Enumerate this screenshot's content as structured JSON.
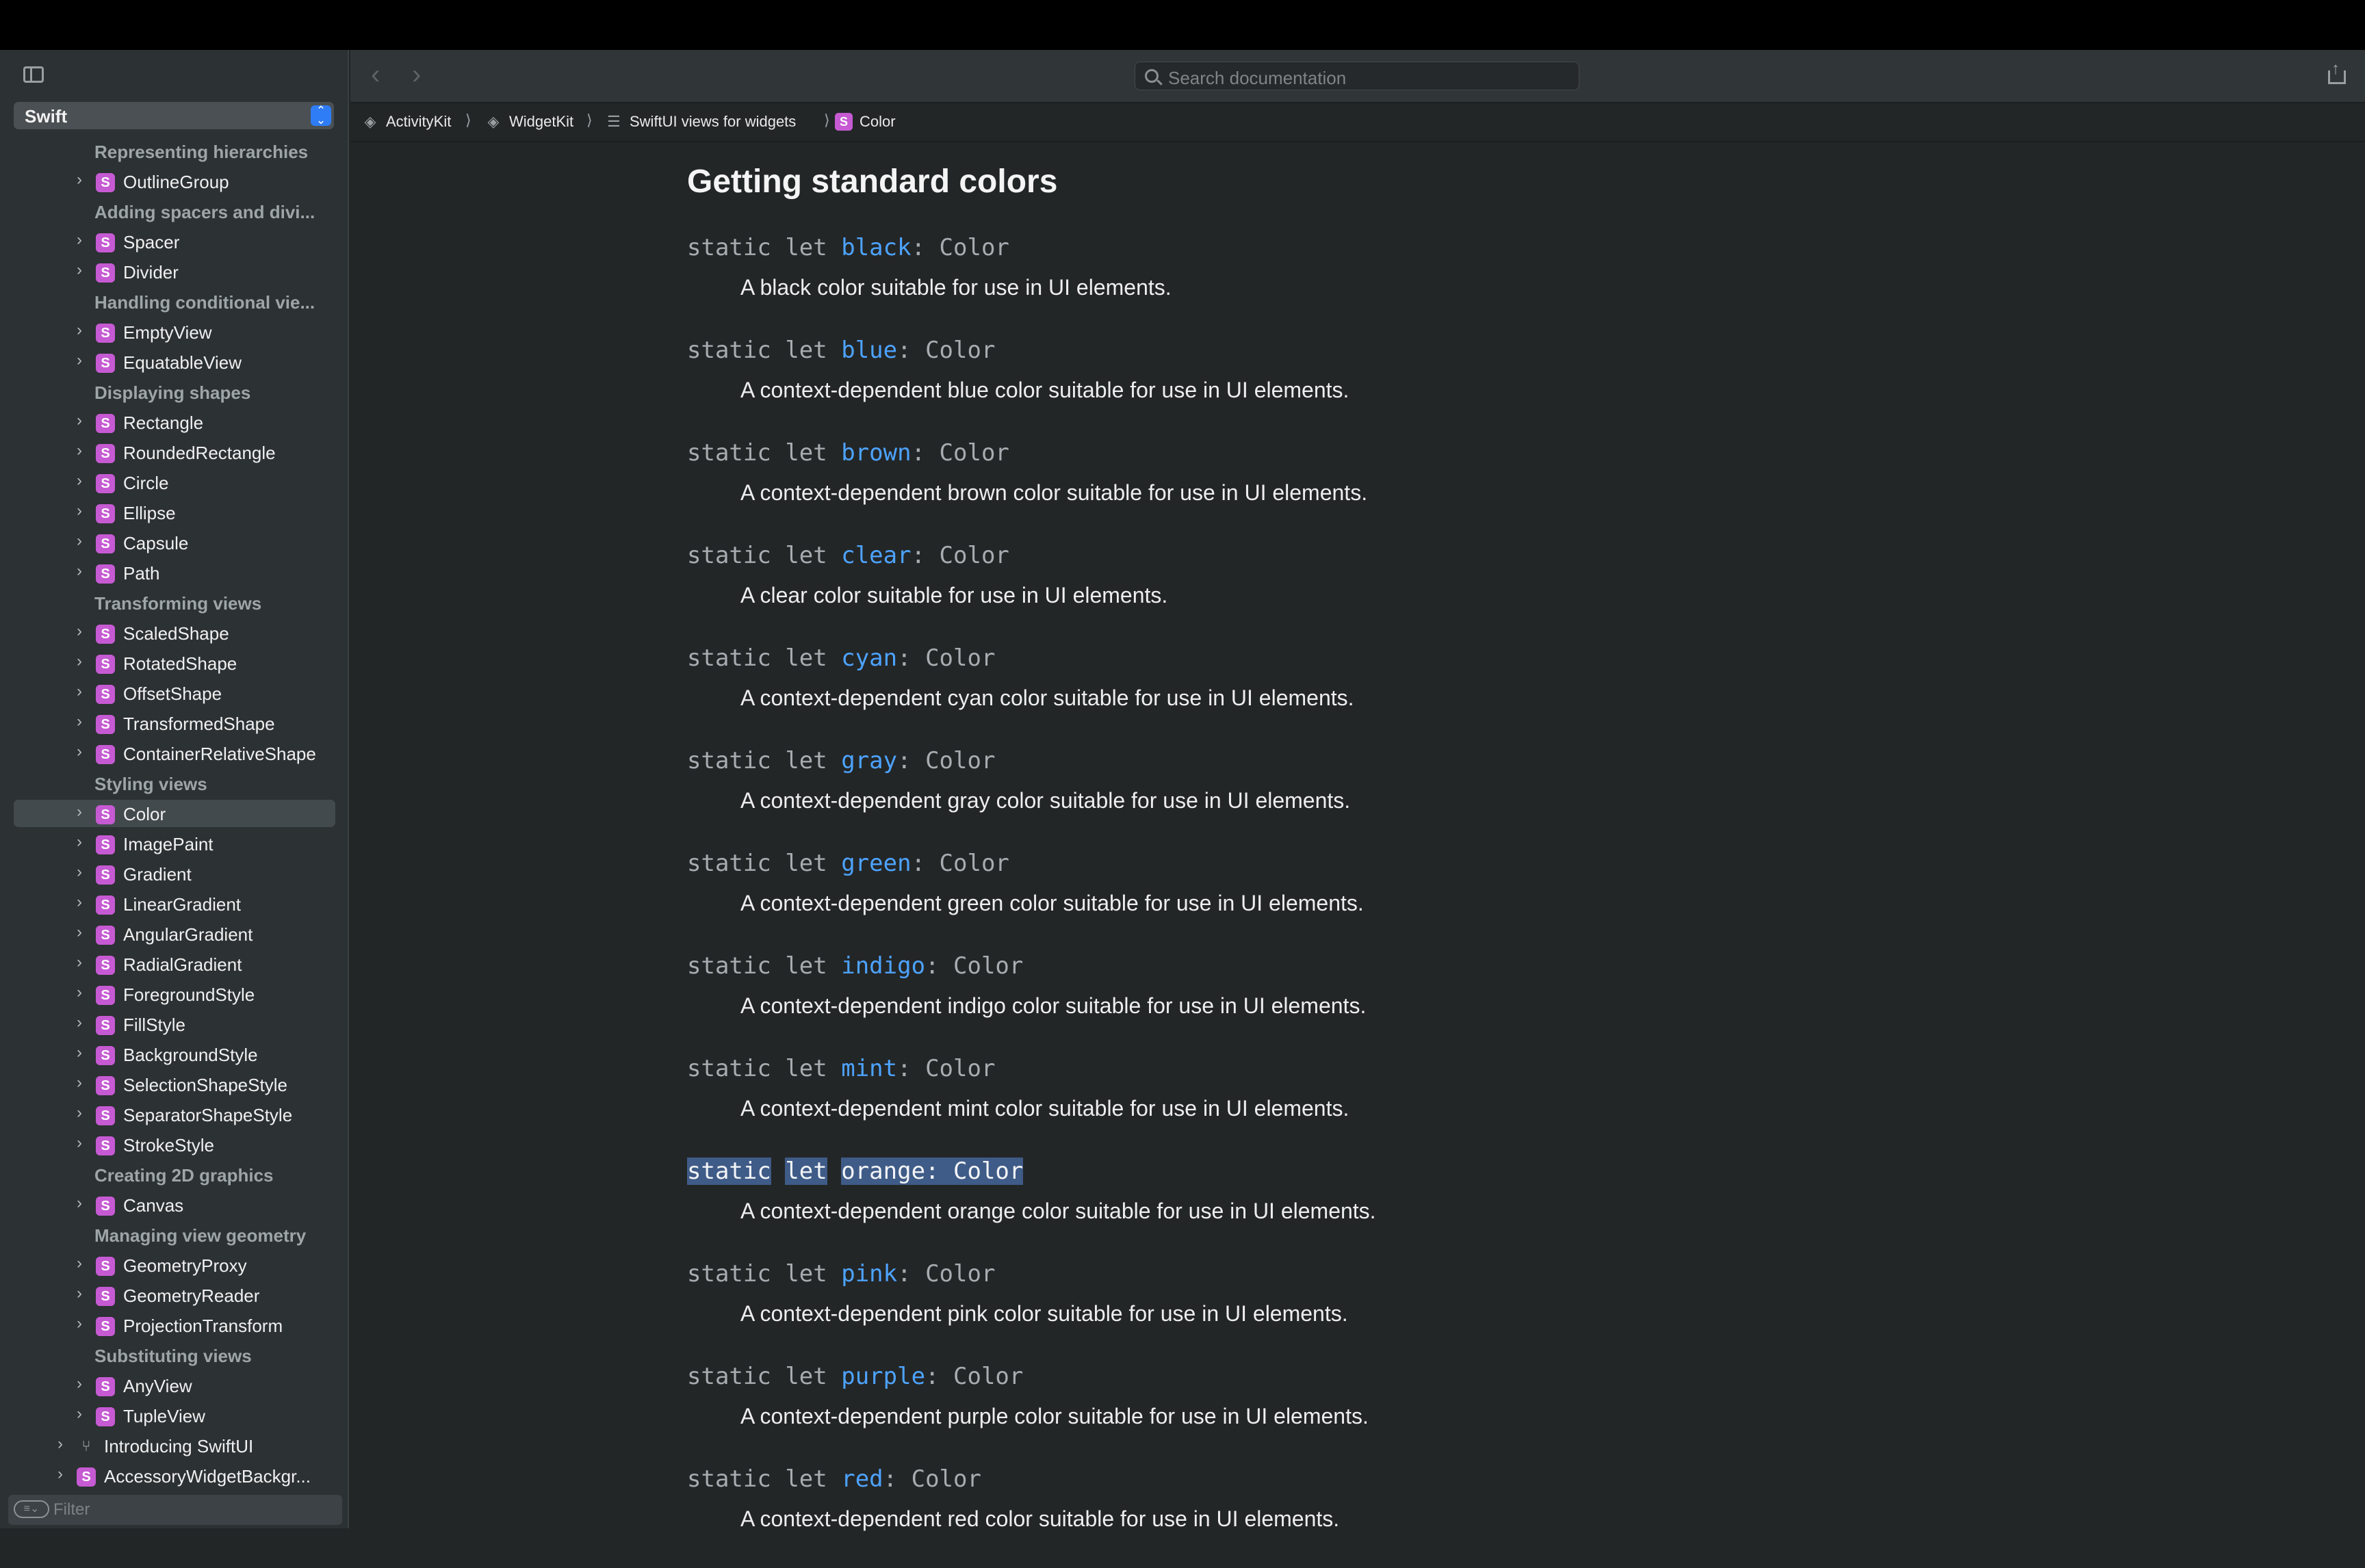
{
  "sidebar": {
    "language": "Swift",
    "filter_placeholder": "Filter",
    "items": [
      {
        "kind": "section",
        "label": "Representing hierarchies"
      },
      {
        "kind": "symbol",
        "label": "OutlineGroup"
      },
      {
        "kind": "section",
        "label": "Adding spacers and divi..."
      },
      {
        "kind": "symbol",
        "label": "Spacer"
      },
      {
        "kind": "symbol",
        "label": "Divider"
      },
      {
        "kind": "section",
        "label": "Handling conditional vie..."
      },
      {
        "kind": "symbol",
        "label": "EmptyView"
      },
      {
        "kind": "symbol",
        "label": "EquatableView"
      },
      {
        "kind": "section",
        "label": "Displaying shapes"
      },
      {
        "kind": "symbol",
        "label": "Rectangle"
      },
      {
        "kind": "symbol",
        "label": "RoundedRectangle"
      },
      {
        "kind": "symbol",
        "label": "Circle"
      },
      {
        "kind": "symbol",
        "label": "Ellipse"
      },
      {
        "kind": "symbol",
        "label": "Capsule"
      },
      {
        "kind": "symbol",
        "label": "Path"
      },
      {
        "kind": "section",
        "label": "Transforming views"
      },
      {
        "kind": "symbol",
        "label": "ScaledShape"
      },
      {
        "kind": "symbol",
        "label": "RotatedShape"
      },
      {
        "kind": "symbol",
        "label": "OffsetShape"
      },
      {
        "kind": "symbol",
        "label": "TransformedShape"
      },
      {
        "kind": "symbol",
        "label": "ContainerRelativeShape"
      },
      {
        "kind": "section",
        "label": "Styling views"
      },
      {
        "kind": "symbol",
        "label": "Color",
        "selected": true
      },
      {
        "kind": "symbol",
        "label": "ImagePaint"
      },
      {
        "kind": "symbol",
        "label": "Gradient"
      },
      {
        "kind": "symbol",
        "label": "LinearGradient"
      },
      {
        "kind": "symbol",
        "label": "AngularGradient"
      },
      {
        "kind": "symbol",
        "label": "RadialGradient"
      },
      {
        "kind": "symbol",
        "label": "ForegroundStyle"
      },
      {
        "kind": "symbol",
        "label": "FillStyle"
      },
      {
        "kind": "symbol",
        "label": "BackgroundStyle"
      },
      {
        "kind": "symbol",
        "label": "SelectionShapeStyle"
      },
      {
        "kind": "symbol",
        "label": "SeparatorShapeStyle"
      },
      {
        "kind": "symbol",
        "label": "StrokeStyle"
      },
      {
        "kind": "section",
        "label": "Creating 2D graphics"
      },
      {
        "kind": "symbol",
        "label": "Canvas"
      },
      {
        "kind": "section",
        "label": "Managing view geometry"
      },
      {
        "kind": "symbol",
        "label": "GeometryProxy"
      },
      {
        "kind": "symbol",
        "label": "GeometryReader"
      },
      {
        "kind": "symbol",
        "label": "ProjectionTransform"
      },
      {
        "kind": "section",
        "label": "Substituting views"
      },
      {
        "kind": "symbol",
        "label": "AnyView"
      },
      {
        "kind": "symbol",
        "label": "TupleView"
      },
      {
        "kind": "tutorial",
        "label": "Introducing SwiftUI",
        "depth": 1
      },
      {
        "kind": "symbol",
        "label": "AccessoryWidgetBackgr...",
        "depth": 1
      }
    ]
  },
  "toolbar": {
    "search_placeholder": "Search documentation",
    "back_icon": "chevron-left-icon",
    "forward_icon": "chevron-right-icon",
    "share_icon": "share-icon"
  },
  "breadcrumb": [
    {
      "label": "ActivityKit",
      "icon": "framework"
    },
    {
      "label": "WidgetKit",
      "icon": "framework"
    },
    {
      "label": "SwiftUI views for widgets",
      "icon": "list"
    },
    {
      "label": "Color",
      "icon": "symbol"
    }
  ],
  "content": {
    "heading": "Getting standard colors",
    "keyword1": "static",
    "keyword2": "let",
    "type": "Color",
    "entries": [
      {
        "name": "black",
        "desc": "A black color suitable for use in UI elements."
      },
      {
        "name": "blue",
        "desc": "A context-dependent blue color suitable for use in UI elements."
      },
      {
        "name": "brown",
        "desc": "A context-dependent brown color suitable for use in UI elements."
      },
      {
        "name": "clear",
        "desc": "A clear color suitable for use in UI elements."
      },
      {
        "name": "cyan",
        "desc": "A context-dependent cyan color suitable for use in UI elements."
      },
      {
        "name": "gray",
        "desc": "A context-dependent gray color suitable for use in UI elements."
      },
      {
        "name": "green",
        "desc": "A context-dependent green color suitable for use in UI elements."
      },
      {
        "name": "indigo",
        "desc": "A context-dependent indigo color suitable for use in UI elements."
      },
      {
        "name": "mint",
        "desc": "A context-dependent mint color suitable for use in UI elements."
      },
      {
        "name": "orange",
        "desc": "A context-dependent orange color suitable for use in UI elements.",
        "highlighted": true
      },
      {
        "name": "pink",
        "desc": "A context-dependent pink color suitable for use in UI elements."
      },
      {
        "name": "purple",
        "desc": "A context-dependent purple color suitable for use in UI elements."
      },
      {
        "name": "red",
        "desc": "A context-dependent red color suitable for use in UI elements."
      }
    ]
  },
  "colors": {
    "accent": "#4da3ff",
    "symbol_badge": "#c65ad3",
    "selection": "#3f5b87"
  }
}
